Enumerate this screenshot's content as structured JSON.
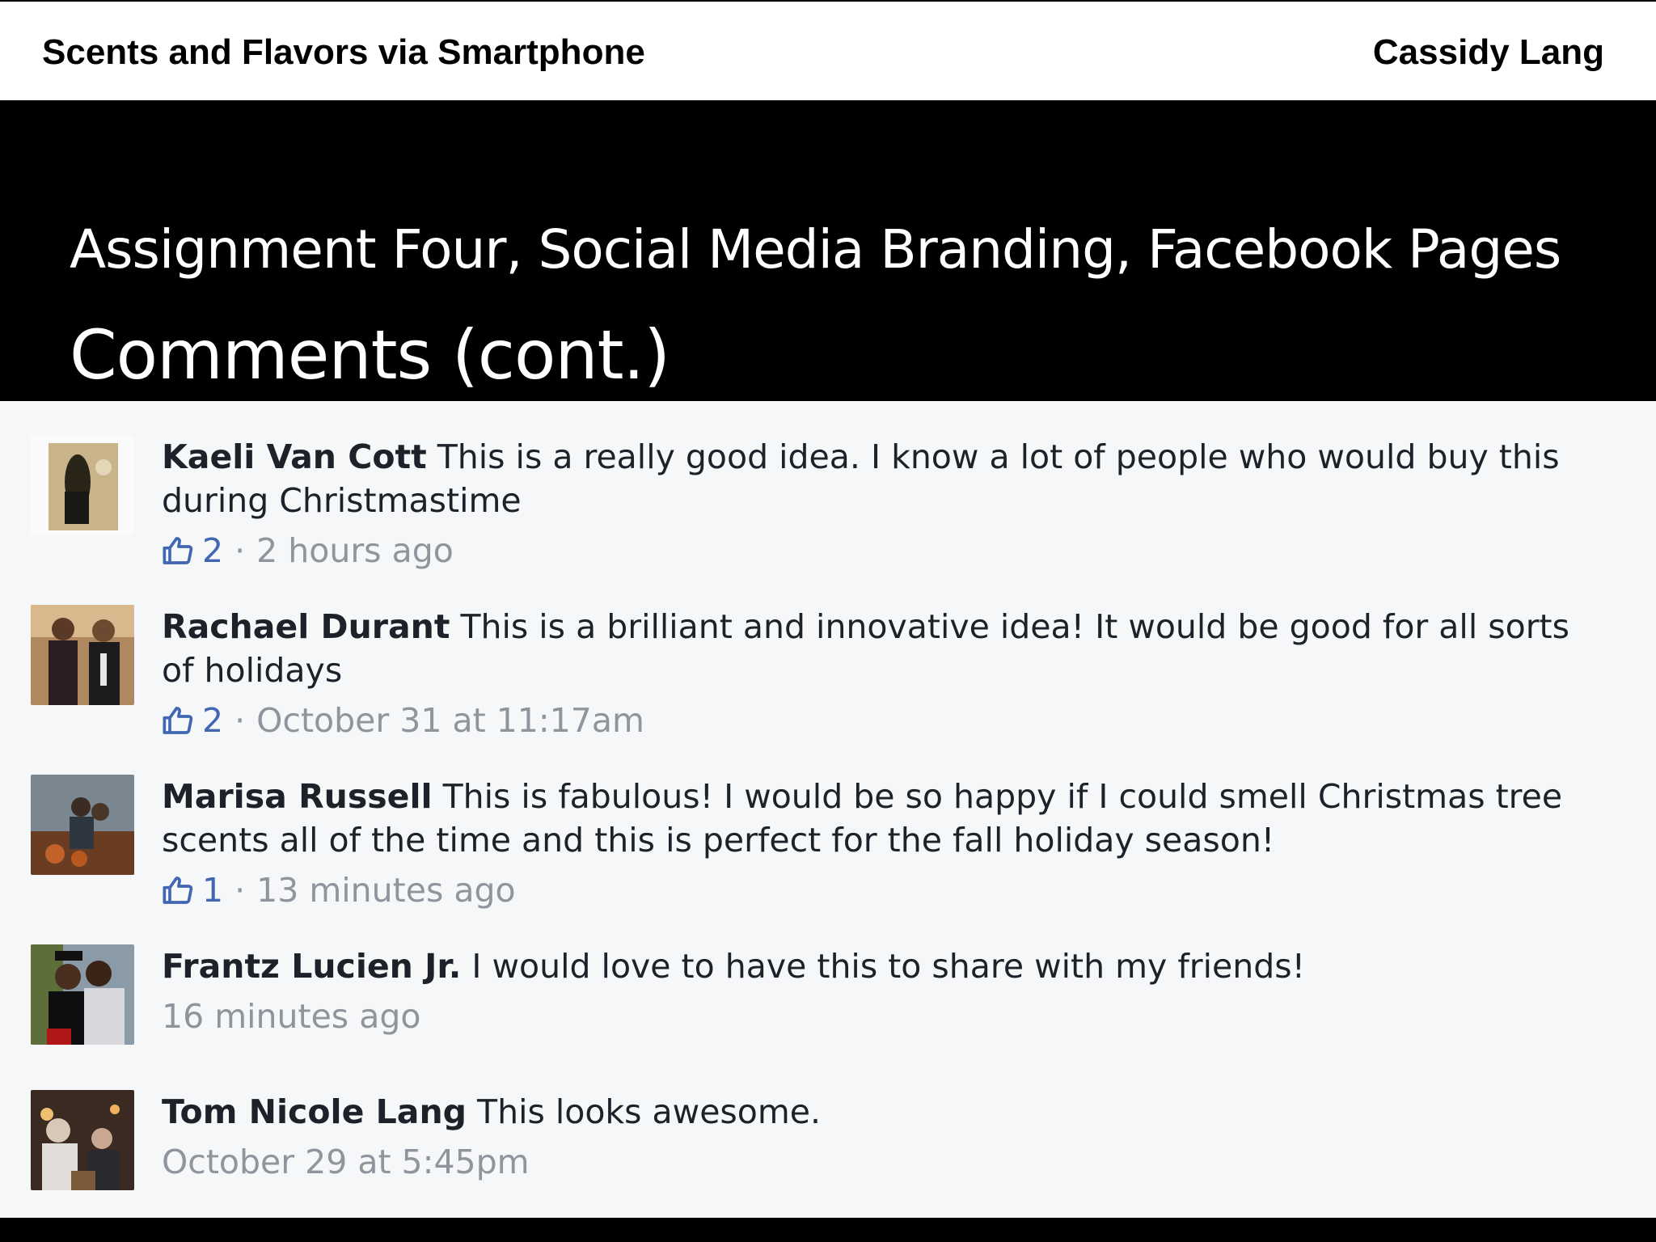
{
  "header": {
    "left_title": "Scents and Flavors via Smartphone",
    "right_title": "Cassidy Lang"
  },
  "slide": {
    "title": "Assignment Four, Social Media Branding, Facebook Pages",
    "subtitle": "Comments (cont.)"
  },
  "comments": [
    {
      "name": "Kaeli Van Cott",
      "text": " This is a really good idea. I know a lot of people who would buy this during Christmastime",
      "likes": "2",
      "time": "2 hours ago"
    },
    {
      "name": "Rachael Durant",
      "text": " This is a brilliant and innovative idea! It would be good for all sorts of holidays",
      "likes": "2",
      "time": "October 31 at 11:17am"
    },
    {
      "name": "Marisa Russell",
      "text": " This is fabulous! I would be so happy if I could smell Christmas tree scents all of the time and this is perfect for the fall holiday season!",
      "likes": "1",
      "time": "13 minutes ago"
    },
    {
      "name": "Frantz Lucien Jr.",
      "text": " I would love to have this to share with my friends!",
      "likes": null,
      "time": "16 minutes ago"
    },
    {
      "name": "Tom Nicole Lang",
      "text": " This looks awesome.",
      "likes": null,
      "time": "October 29 at 5:45pm"
    }
  ],
  "colors": {
    "like_blue": "#4267b2",
    "meta_gray": "#90949c",
    "text_dark": "#1d2129"
  },
  "icons": {
    "like": "thumbs-up-icon"
  }
}
